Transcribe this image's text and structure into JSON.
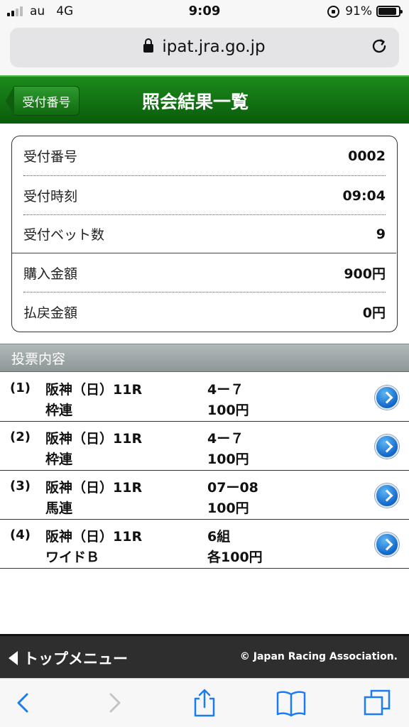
{
  "status_bar": {
    "carrier": "au",
    "network": "4G",
    "time": "9:09",
    "battery": "91%",
    "battery_level": 0.91
  },
  "browser": {
    "url": "ipat.jra.go.jp",
    "icons": [
      "padlock-icon",
      "reload-icon",
      "back-icon",
      "forward-icon",
      "share-icon",
      "bookmarks-icon",
      "tabs-icon"
    ]
  },
  "header": {
    "back_label": "受付番号",
    "title": "照会結果一覧",
    "color": "#0f6a0f"
  },
  "summary": [
    {
      "label": "受付番号",
      "value": "0002"
    },
    {
      "label": "受付時刻",
      "value": "09:04"
    },
    {
      "label": "受付ベット数",
      "value": "9"
    },
    {
      "label": "購入金額",
      "value": "900円"
    },
    {
      "label": "払戻金額",
      "value": "0円"
    }
  ],
  "section_title": "投票内容",
  "bets": [
    {
      "num": "(1)",
      "race": "阪神（日）11R",
      "type": "枠連",
      "combo": "4ー７",
      "amount": "100円"
    },
    {
      "num": "(2)",
      "race": "阪神（日）11R",
      "type": "枠連",
      "combo": "4ー７",
      "amount": "100円"
    },
    {
      "num": "(3)",
      "race": "阪神（日）11R",
      "type": "馬連",
      "combo": "07ー08",
      "amount": "100円"
    },
    {
      "num": "(4)",
      "race": "阪神（日）11R",
      "type": "ワイドＢ",
      "combo": "6組",
      "amount": "各100円"
    }
  ],
  "footer": {
    "top_menu": "トップメニュー",
    "copyright": "© Japan Racing Association."
  }
}
